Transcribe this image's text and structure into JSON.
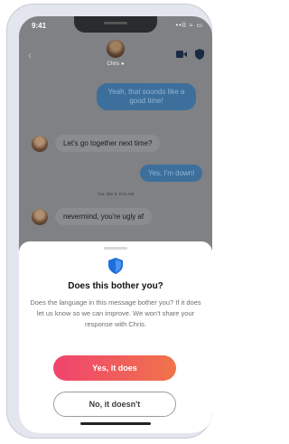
{
  "status_bar": {
    "time": "9:41",
    "icons": "••ll ≈ ▭"
  },
  "header": {
    "contact_name": "Chris"
  },
  "messages": {
    "out1": "Yeah, that sounds like a good time!",
    "in1": "Let's go together next time?",
    "out2": "Yes, I'm down!",
    "timestamp": "Tue, Mar 8, 9:01 AM",
    "in2": "nevermind, you're ugly af"
  },
  "sheet": {
    "title": "Does this bother you?",
    "body": "Does the language in this message bother you? If it does let us know so we can improve. We won't share your response with Chris.",
    "yes_label": "Yes, it does",
    "no_label": "No, it doesn't"
  },
  "colors": {
    "accent_start": "#f0446f",
    "accent_end": "#f0744a",
    "shield": "#1e6fd9"
  }
}
